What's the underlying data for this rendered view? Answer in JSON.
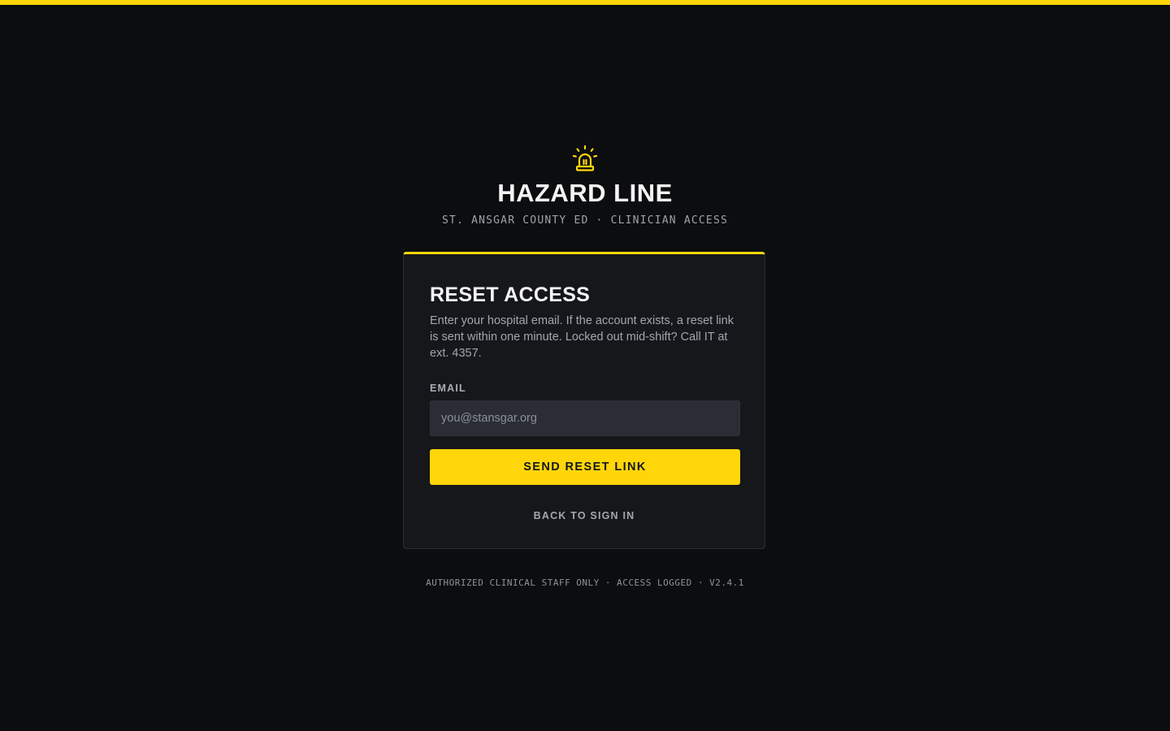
{
  "colors": {
    "accent": "#ffd60a",
    "background": "#0c0d0f",
    "card": "#15171b",
    "input": "#2a2d33"
  },
  "brand": {
    "icon": "siren-icon",
    "title": "HAZARD LINE",
    "subtitle": "ST. ANSGAR COUNTY ED · CLINICIAN ACCESS"
  },
  "card": {
    "title": "RESET ACCESS",
    "description": "Enter your hospital email. If the account exists, a reset link is sent within one minute. Locked out mid-shift? Call IT at ext. 4357.",
    "email": {
      "label": "EMAIL",
      "value": "",
      "placeholder": "you@stansgar.org"
    },
    "submit_label": "SEND RESET LINK",
    "back_label": "BACK TO SIGN IN"
  },
  "footer": {
    "note": "AUTHORIZED CLINICAL STAFF ONLY · ACCESS LOGGED · V2.4.1"
  }
}
